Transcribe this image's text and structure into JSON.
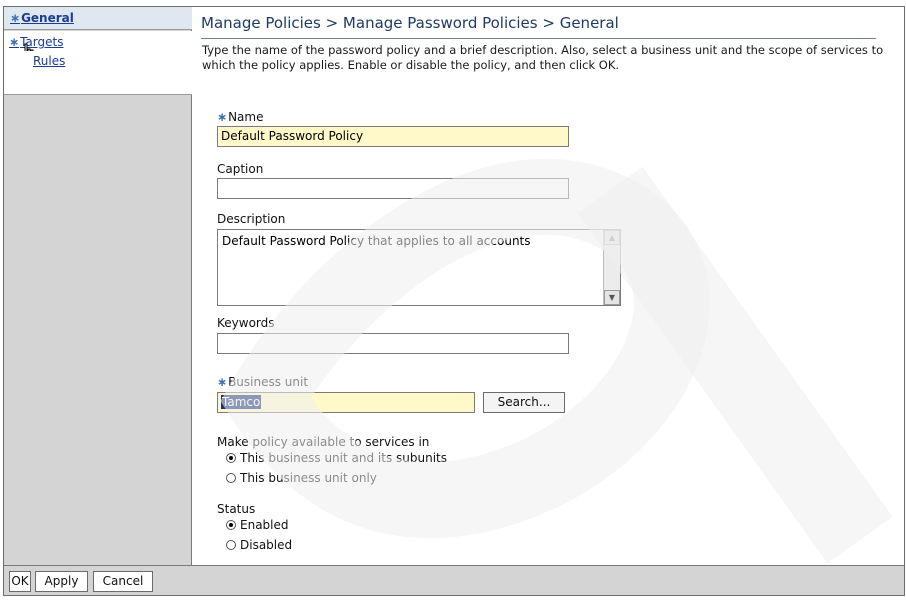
{
  "nav": {
    "items": [
      {
        "label": "General",
        "required": true,
        "active": true
      },
      {
        "label": "Targets",
        "required": true,
        "active": false
      },
      {
        "label": "Rules",
        "required": false,
        "active": false
      }
    ],
    "required_marker": "∗"
  },
  "page": {
    "title": "Manage Policies > Manage Password Policies > General",
    "intro": "Type the name of the password policy and a brief description. Also, select a business unit and the scope of services to which the policy applies. Enable or disable the policy, and then click OK."
  },
  "form": {
    "name": {
      "label": "Name",
      "value": "Default Password Policy",
      "required": true
    },
    "caption": {
      "label": "Caption",
      "value": ""
    },
    "description": {
      "label": "Description",
      "value": "Default Password Policy that applies to all accounts"
    },
    "keywords": {
      "label": "Keywords",
      "value": ""
    },
    "business_unit": {
      "label": "Business unit",
      "value": "Tamco",
      "required": true,
      "search_label": "Search..."
    },
    "scope": {
      "label": "Make policy available to services in",
      "options": [
        "This business unit and its subunits",
        "This business unit only"
      ],
      "selected": "This business unit and its subunits"
    },
    "status": {
      "label": "Status",
      "options": [
        "Enabled",
        "Disabled"
      ],
      "selected": "Enabled"
    }
  },
  "buttons": {
    "ok": "OK",
    "apply": "Apply",
    "cancel": "Cancel"
  },
  "colors": {
    "nav_bg": "#d4d4d4",
    "active_nav_bg": "#dfe7f1",
    "link": "#1a3d8f",
    "required_field_bg": "#fff8c9",
    "title": "#1f3a66"
  }
}
